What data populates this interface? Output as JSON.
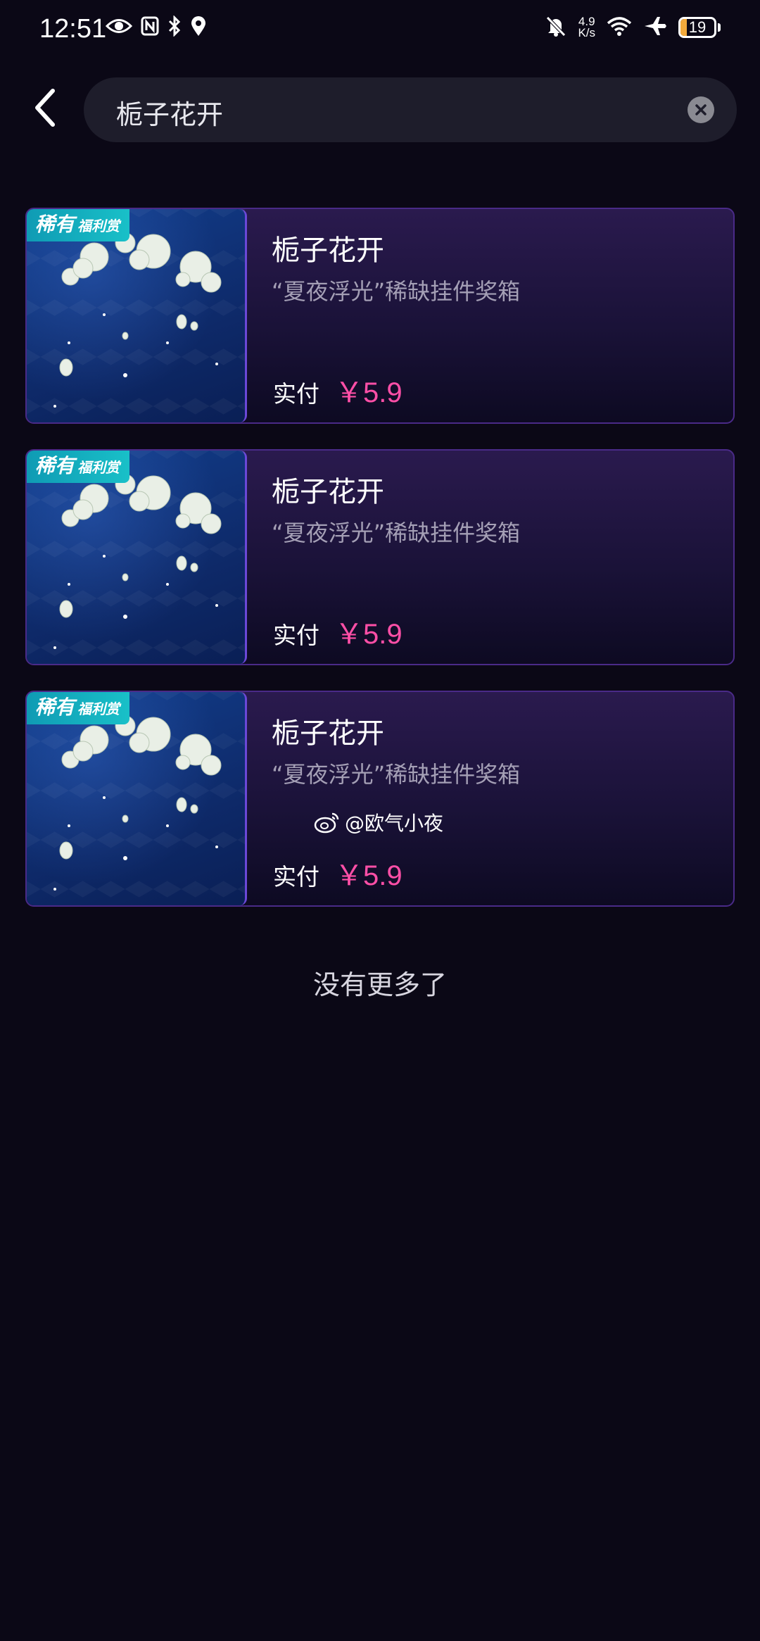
{
  "status_bar": {
    "time": "12:51",
    "net_speed_value": "4.9",
    "net_speed_unit": "K/s",
    "battery_level": "19",
    "icons": [
      "eye-icon",
      "nfc-icon",
      "bluetooth-icon",
      "location-icon",
      "mute-icon",
      "wifi-icon",
      "airplane-icon",
      "battery-icon"
    ]
  },
  "search": {
    "query": "栀子花开"
  },
  "results": [
    {
      "badge_main": "稀有",
      "badge_sub": "福利赏",
      "title": "栀子花开",
      "description": "“夏夜浮光”稀缺挂件奖箱",
      "price_label": "实付",
      "price": "￥5.9"
    },
    {
      "badge_main": "稀有",
      "badge_sub": "福利赏",
      "title": "栀子花开",
      "description": "“夏夜浮光”稀缺挂件奖箱",
      "price_label": "实付",
      "price": "￥5.9"
    },
    {
      "badge_main": "稀有",
      "badge_sub": "福利赏",
      "title": "栀子花开",
      "description": "“夏夜浮光”稀缺挂件奖箱",
      "price_label": "实付",
      "price": "￥5.9"
    }
  ],
  "watermark": "@欧气小夜",
  "footer": {
    "no_more": "没有更多了"
  },
  "colors": {
    "background": "#0b0816",
    "price": "#ff4fa7",
    "badge": "#19c0c8",
    "battery": "#f2a93b"
  }
}
